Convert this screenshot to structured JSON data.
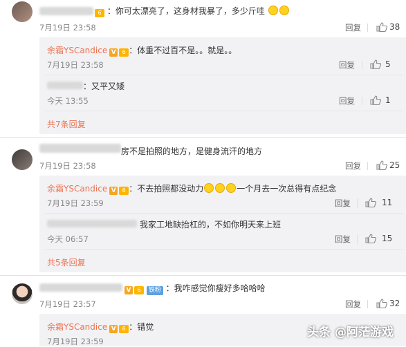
{
  "comments": [
    {
      "text": "：你可太漂亮了，这身材我暴了，多少斤哇",
      "time": "7月19日 23:58",
      "reply": "回复",
      "likes": "38"
    },
    {
      "text": "房不是拍照的地方，是健身流汗的地方",
      "time": "7月19日 23:58",
      "reply": "回复",
      "likes": "25"
    },
    {
      "text": "：我咋感觉你瘦好多哈哈哈",
      "fan_label": "铁粉",
      "time": "7月19日 23:57",
      "reply": "回复",
      "likes": "32"
    }
  ],
  "sub_replies": [
    {
      "author": "余霜YSCandice",
      "text": "：体重不过百不是。。就是。。",
      "time": "7月19日 23:58",
      "reply": "回复",
      "likes": "5"
    },
    {
      "text": "：又平又矮",
      "time": "今天 13:55",
      "reply": "回复",
      "likes": "1"
    },
    {
      "author": "余霜YSCandice",
      "text_a": "：不去拍照都没动力",
      "text_b": "一个月去一次总得有点纪念",
      "time": "7月19日 23:59",
      "reply": "回复",
      "likes": "11"
    },
    {
      "text": "我家工地缺抬杠的，不如你明天来上班",
      "time": "今天 06:57",
      "reply": "回复",
      "likes": "15"
    },
    {
      "author": "余霜YSCandice",
      "text": "：错觉",
      "time": "7月19日 23:59"
    }
  ],
  "more_links": [
    "共7条回复",
    "共5条回复"
  ],
  "badges": {
    "v": "V",
    "lvl": "6"
  },
  "watermark": "头条 @阿茫游戏",
  "colors": {
    "name": "#eb7350",
    "subbox": "#f2f2f5"
  }
}
